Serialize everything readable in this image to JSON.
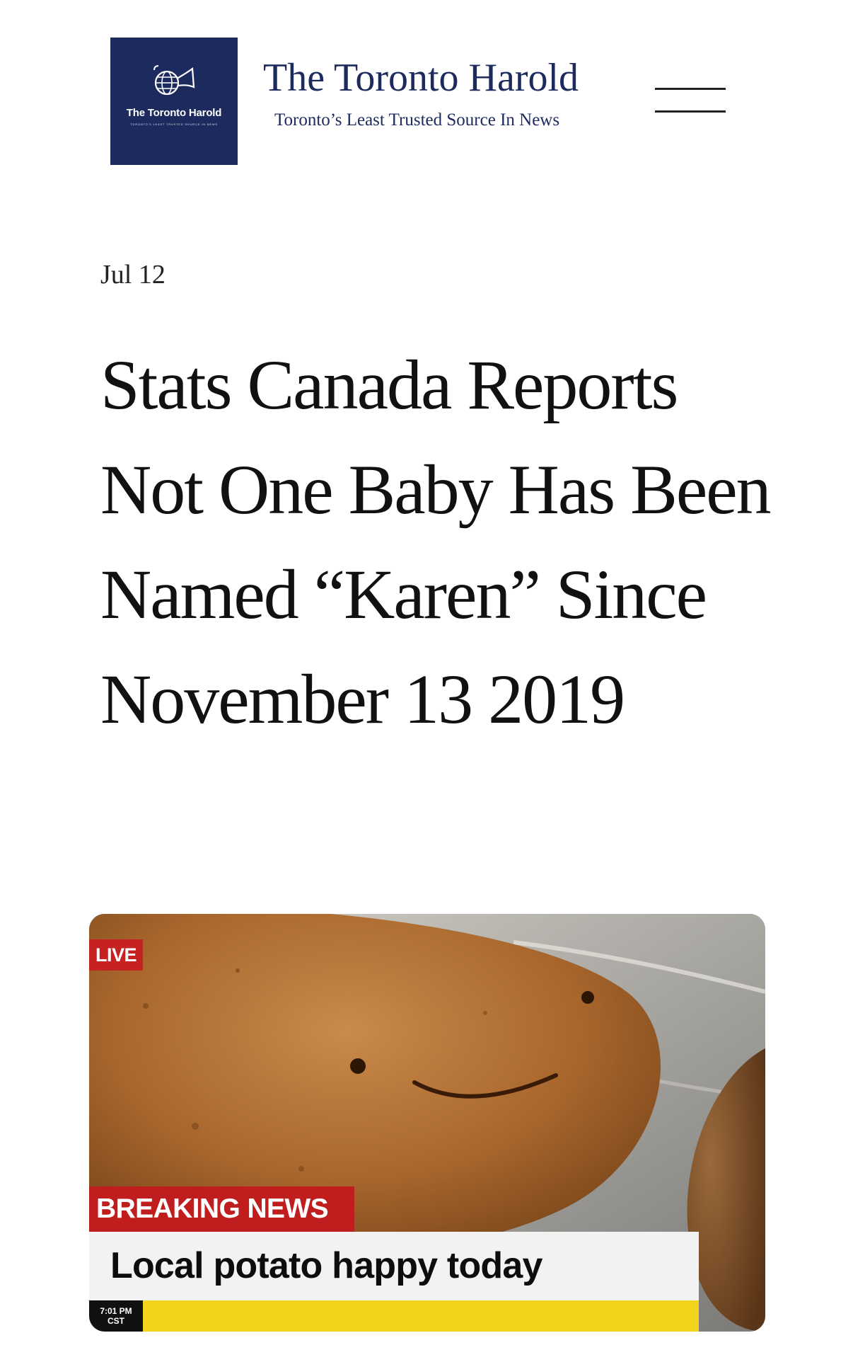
{
  "header": {
    "logo_name": "The Toronto Harold",
    "logo_tagline": "Toronto's Least Trusted Source In News",
    "site_title": "The Toronto Harold",
    "site_tagline": "Toronto’s Least Trusted Source In News",
    "menu_icon": "hamburger-menu-icon"
  },
  "article": {
    "date": "Jul 12",
    "headline": "Stats Canada Reports Not One Baby Has Been Named “Karen” Since November 13 2019"
  },
  "news_image": {
    "live_label": "LIVE",
    "breaking_label": "BREAKING NEWS",
    "caption": "Local potato happy today",
    "time": "7:01 PM",
    "timezone": "CST",
    "colors": {
      "breaking_red": "#c01e1e",
      "ticker_yellow": "#f2d41c",
      "logo_navy": "#1c2a5e"
    }
  }
}
